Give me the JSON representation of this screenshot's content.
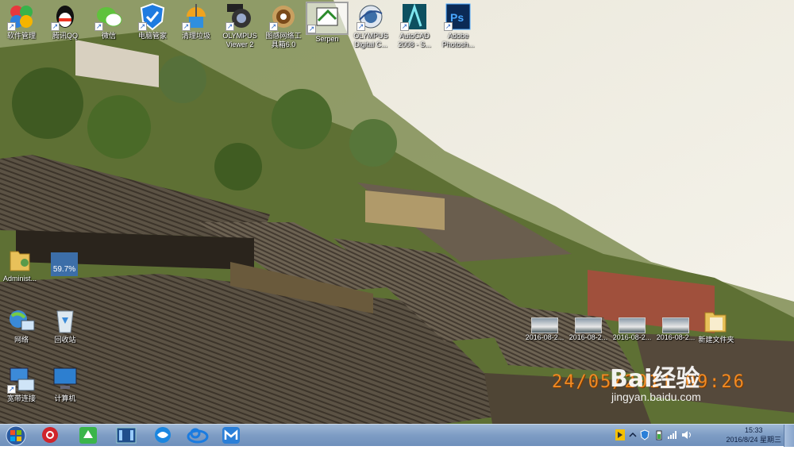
{
  "desktop": {
    "top_icons": [
      {
        "label": "软件管理",
        "icon": "software-manager-icon"
      },
      {
        "label": "腾讯QQ",
        "icon": "qq-icon"
      },
      {
        "label": "微信",
        "icon": "wechat-icon"
      },
      {
        "label": "电脑管家",
        "icon": "pc-manager-icon"
      },
      {
        "label": "清理垃圾",
        "icon": "clean-trash-icon"
      },
      {
        "label": "OLYMPUS\nViewer 2",
        "icon": "olympus-viewer-icon"
      },
      {
        "label": "图感网络工\n具箱6.0",
        "icon": "network-toolbox-icon"
      },
      {
        "label": "Serpen",
        "icon": "serpen-icon"
      },
      {
        "label": "OLYMPUS\nDigital C...",
        "icon": "olympus-digital-icon"
      },
      {
        "label": "AutoCAD\n2008 - S...",
        "icon": "autocad-icon"
      },
      {
        "label": "Adobe\nPhotosh...",
        "icon": "photoshop-icon"
      }
    ],
    "left_icons": [
      {
        "label": "Administ...",
        "icon": "user-folder-icon"
      },
      {
        "label": "网络",
        "icon": "network-icon"
      },
      {
        "label": "回收站",
        "icon": "recycle-bin-icon"
      },
      {
        "label": "宽带连接",
        "icon": "broadband-icon"
      },
      {
        "label": "计算机",
        "icon": "computer-icon"
      }
    ],
    "progress_widget": {
      "text": "59.7%",
      "value": 59.7
    },
    "file_icons": [
      {
        "label": "2016-08-2..."
      },
      {
        "label": "2016-08-2..."
      },
      {
        "label": "2016-08-2..."
      },
      {
        "label": "2016-08-2..."
      },
      {
        "label": "新建文件夹"
      }
    ],
    "photo_timestamp": "24/05/2011  09:26",
    "watermark": {
      "logo": "Bai经验",
      "url": "jingyan.baidu.com"
    }
  },
  "taskbar": {
    "start": "windows-start-icon",
    "pinned": [
      "netease-music-icon",
      "iqiyi-icon",
      "video-player-icon",
      "browser-icon",
      "cloud-sync-icon",
      "maxthon-icon"
    ],
    "tray_icons": [
      "tray-app-icon",
      "tray-expand-icon",
      "shield-icon",
      "battery-icon",
      "signal-icon",
      "volume-icon"
    ],
    "clock": {
      "time": "15:33",
      "date": "2016/8/24 星期三"
    }
  }
}
